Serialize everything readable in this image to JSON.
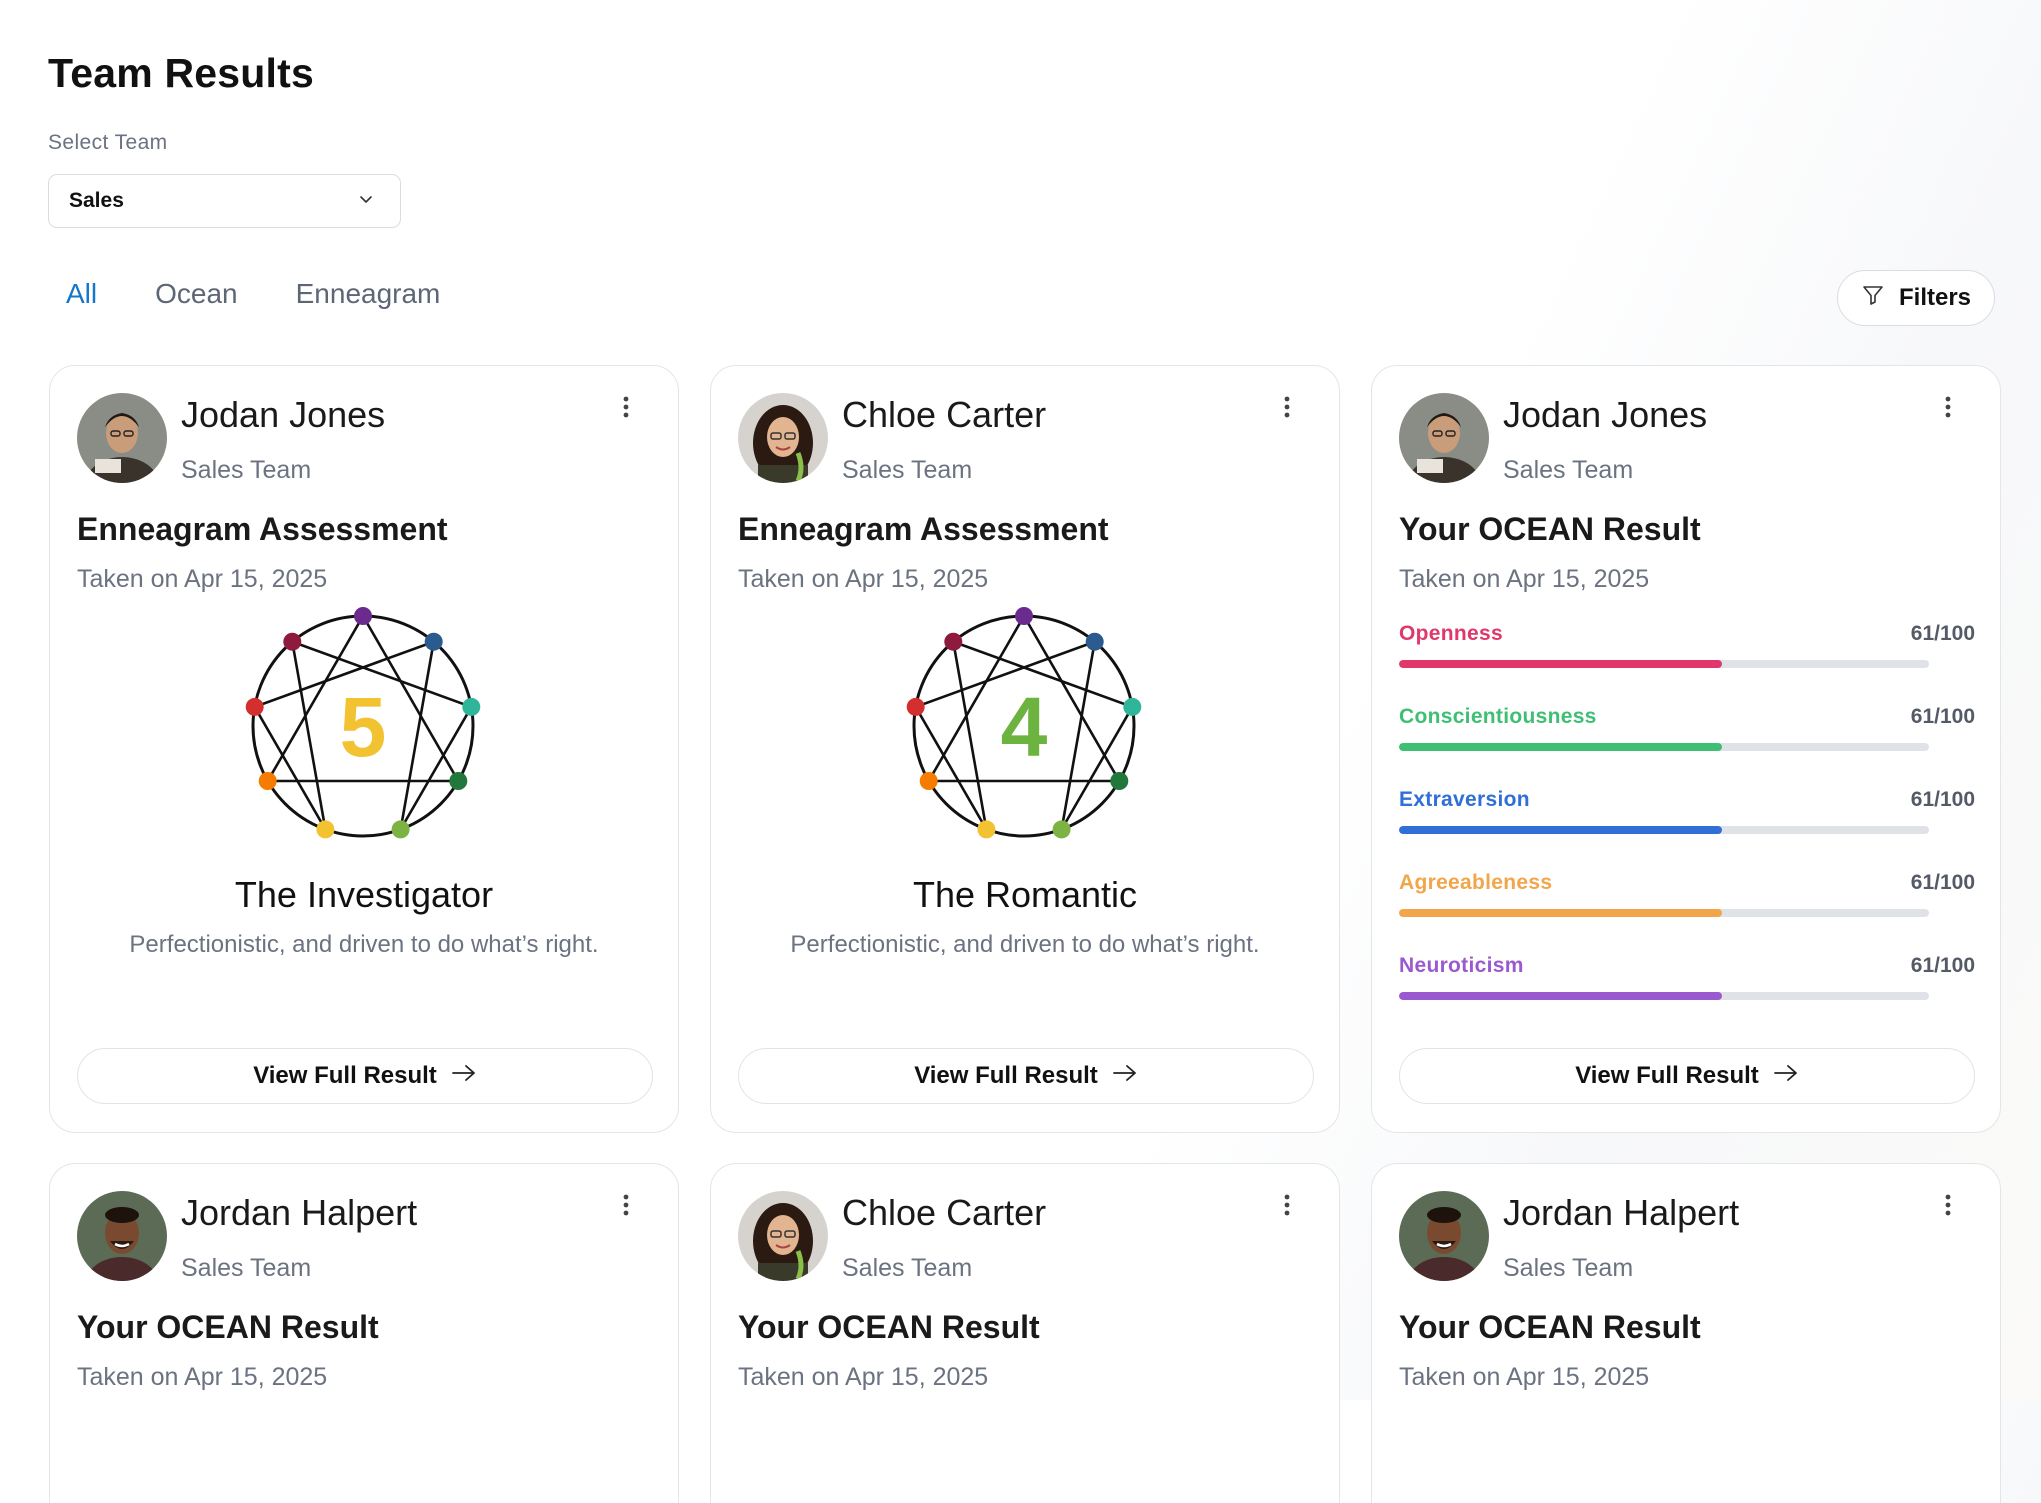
{
  "page": {
    "title": "Team Results",
    "select_label": "Select Team",
    "selected_team": "Sales",
    "tabs": [
      {
        "label": "All",
        "active": true
      },
      {
        "label": "Ocean",
        "active": false
      },
      {
        "label": "Enneagram",
        "active": false
      }
    ],
    "filters_label": "Filters"
  },
  "colors": {
    "accent": "#1676c7",
    "openness": "#e0386a",
    "conscientiousness": "#3fbf74",
    "extraversion": "#2f6fd6",
    "agreeableness": "#f2a54a",
    "neuroticism": "#9b59d0"
  },
  "cards": [
    {
      "name": "Jodan Jones",
      "team": "Sales Team",
      "avatar": "avatar-1",
      "type": "enneagram",
      "title": "Enneagram Assessment",
      "taken": "Taken on Apr 15, 2025",
      "enneagram_number": "5",
      "number_color": "#f2c230",
      "type_name": "The Investigator",
      "description": "Perfectionistic, and driven to do what’s right.",
      "button": "View Full Result"
    },
    {
      "name": "Chloe Carter",
      "team": "Sales Team",
      "avatar": "avatar-2",
      "type": "enneagram",
      "title": "Enneagram Assessment",
      "taken": "Taken on Apr 15, 2025",
      "enneagram_number": "4",
      "number_color": "#6db33f",
      "type_name": "The Romantic",
      "description": "Perfectionistic, and driven to do what’s right.",
      "button": "View Full Result"
    },
    {
      "name": "Jodan Jones",
      "team": "Sales Team",
      "avatar": "avatar-1",
      "type": "ocean",
      "title": "Your OCEAN Result",
      "taken": "Taken on Apr 15, 2025",
      "traits": [
        {
          "label": "Openness",
          "score": "61/100",
          "value": 61,
          "color_key": "openness"
        },
        {
          "label": "Conscientiousness",
          "score": "61/100",
          "value": 61,
          "color_key": "conscientiousness"
        },
        {
          "label": "Extraversion",
          "score": "61/100",
          "value": 61,
          "color_key": "extraversion"
        },
        {
          "label": "Agreeableness",
          "score": "61/100",
          "value": 61,
          "color_key": "agreeableness"
        },
        {
          "label": "Neuroticism",
          "score": "61/100",
          "value": 61,
          "color_key": "neuroticism"
        }
      ],
      "button": "View Full Result"
    },
    {
      "name": "Jordan Halpert",
      "team": "Sales Team",
      "avatar": "avatar-3",
      "type": "ocean",
      "title": "Your OCEAN Result",
      "taken": "Taken on Apr 15, 2025"
    },
    {
      "name": "Chloe Carter",
      "team": "Sales Team",
      "avatar": "avatar-2",
      "type": "ocean",
      "title": "Your OCEAN Result",
      "taken": "Taken on Apr 15, 2025"
    },
    {
      "name": "Jordan Halpert",
      "team": "Sales Team",
      "avatar": "avatar-3",
      "type": "ocean",
      "title": "Your OCEAN Result",
      "taken": "Taken on Apr 15, 2025"
    }
  ]
}
